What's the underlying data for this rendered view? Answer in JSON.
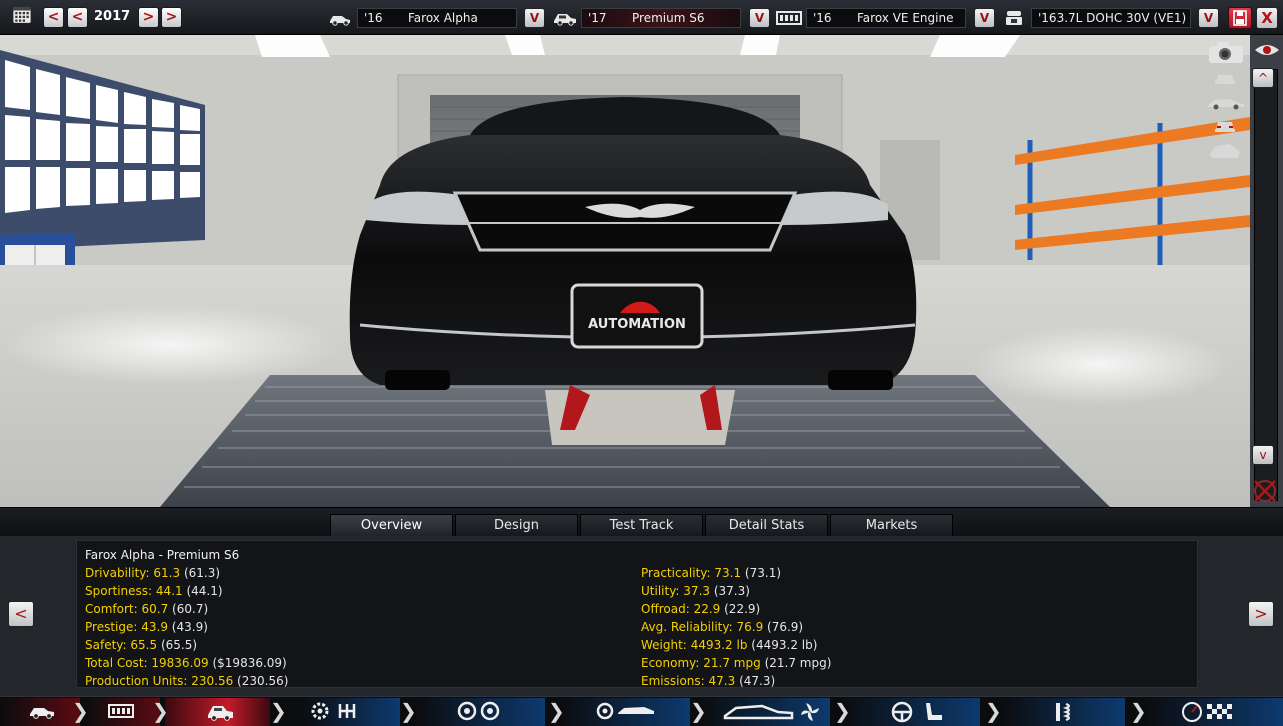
{
  "topbar": {
    "year": "2017",
    "model": {
      "year": "'16",
      "name": "Farox Alpha"
    },
    "trim": {
      "year": "'17",
      "name": "Premium S6"
    },
    "engine_family": {
      "year": "'16",
      "name": "Farox VE Engine"
    },
    "engine_variant": {
      "name": "'163.7L DOHC 30V (VE1)"
    },
    "prev_glyph": "<",
    "next_glyph": ">",
    "dropdown_glyph": "V",
    "close_glyph": "X"
  },
  "scene": {
    "plate_text": "AUTOMATION"
  },
  "rail": {
    "up_glyph": "^",
    "down_glyph": "v"
  },
  "tabs": [
    {
      "label": "Overview",
      "active": true
    },
    {
      "label": "Design",
      "active": false
    },
    {
      "label": "Test Track",
      "active": false
    },
    {
      "label": "Detail Stats",
      "active": false
    },
    {
      "label": "Markets",
      "active": false
    }
  ],
  "panel": {
    "title": "Farox Alpha - Premium S6",
    "left_nav_glyph": "<",
    "right_nav_glyph": ">",
    "left_stats": [
      {
        "label": "Drivability:",
        "value": "61.3",
        "paren": "(61.3)"
      },
      {
        "label": "Sportiness:",
        "value": "44.1",
        "paren": "(44.1)"
      },
      {
        "label": "Comfort:",
        "value": "60.7",
        "paren": "(60.7)"
      },
      {
        "label": "Prestige:",
        "value": "43.9",
        "paren": "(43.9)"
      },
      {
        "label": "Safety:",
        "value": "65.5",
        "paren": "(65.5)"
      },
      {
        "label": "Total Cost:",
        "value": "19836.09",
        "paren": "($19836.09)"
      },
      {
        "label": "Production Units:",
        "value": "230.56",
        "paren": "(230.56)"
      }
    ],
    "right_stats": [
      {
        "label": "Practicality:",
        "value": "73.1",
        "paren": "(73.1)"
      },
      {
        "label": "Utility:",
        "value": "37.3",
        "paren": "(37.3)"
      },
      {
        "label": "Offroad:",
        "value": "22.9",
        "paren": "(22.9)"
      },
      {
        "label": "Avg. Reliability:",
        "value": "76.9",
        "paren": "(76.9)"
      },
      {
        "label": "Weight:",
        "value": "4493.2 lb",
        "paren": "(4493.2 lb)"
      },
      {
        "label": "Economy:",
        "value": "21.7 mpg",
        "paren": "(21.7 mpg)"
      },
      {
        "label": "Emissions:",
        "value": "47.3",
        "paren": "(47.3)"
      }
    ]
  },
  "bottom_nav": {
    "steps": [
      "car-model-icon",
      "engine-block-icon",
      "trim-icon",
      "gearbox-icon",
      "wheels-icon",
      "brakes-icon",
      "aero-icon",
      "interior-icon",
      "suspension-icon",
      "test-track-icon"
    ],
    "accent": "#c41a2a"
  }
}
